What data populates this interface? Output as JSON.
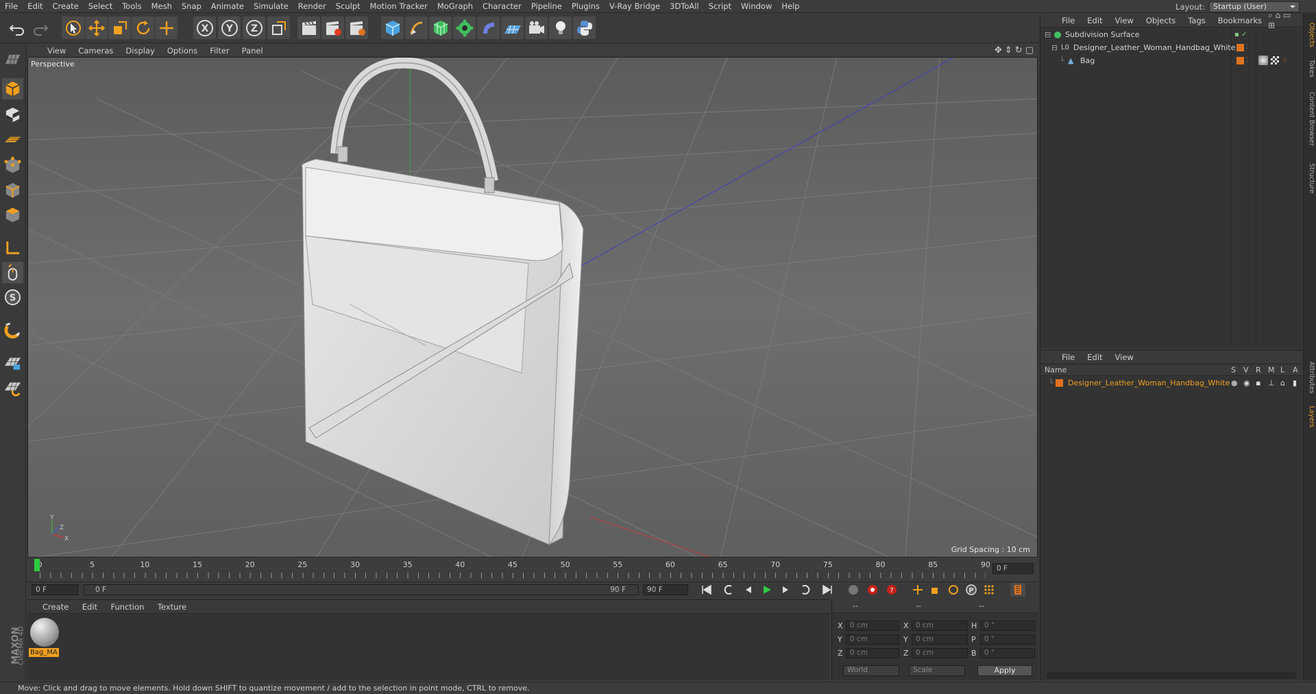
{
  "menubar": {
    "items": [
      "File",
      "Edit",
      "Create",
      "Select",
      "Tools",
      "Mesh",
      "Snap",
      "Animate",
      "Simulate",
      "Render",
      "Sculpt",
      "Motion Tracker",
      "MoGraph",
      "Character",
      "Pipeline",
      "Plugins",
      "V-Ray Bridge",
      "3DToAll",
      "Script",
      "Window",
      "Help"
    ],
    "layout_label": "Layout:",
    "layout_value": "Startup (User)"
  },
  "viewport": {
    "menu": [
      "View",
      "Cameras",
      "Display",
      "Options",
      "Filter",
      "Panel"
    ],
    "label": "Perspective",
    "grid_spacing": "Grid Spacing : 10 cm",
    "axis_x": "X",
    "axis_y": "Y",
    "axis_z": "Z"
  },
  "timeline": {
    "ticks": [
      "0",
      "5",
      "10",
      "15",
      "20",
      "25",
      "30",
      "35",
      "40",
      "45",
      "50",
      "55",
      "60",
      "65",
      "70",
      "75",
      "80",
      "85",
      "90"
    ],
    "current_frame": "0 F"
  },
  "transport": {
    "start": "0 F",
    "range_start": "0 F",
    "range_end": "90 F",
    "end": "90 F"
  },
  "materials": {
    "menu": [
      "Create",
      "Edit",
      "Function",
      "Texture"
    ],
    "items": [
      {
        "name": "Bag_MA"
      }
    ]
  },
  "coords": {
    "header": [
      "--",
      "--",
      "--"
    ],
    "rows": [
      {
        "l1": "X",
        "v1": "0 cm",
        "l2": "X",
        "v2": "0 cm",
        "l3": "H",
        "v3": "0 °"
      },
      {
        "l1": "Y",
        "v1": "0 cm",
        "l2": "Y",
        "v2": "0 cm",
        "l3": "P",
        "v3": "0 °"
      },
      {
        "l1": "Z",
        "v1": "0 cm",
        "l2": "Z",
        "v2": "0 cm",
        "l3": "B",
        "v3": "0 °"
      }
    ],
    "space": "World",
    "mode": "Scale",
    "apply": "Apply"
  },
  "objects": {
    "menu": [
      "File",
      "Edit",
      "View",
      "Objects",
      "Tags",
      "Bookmarks"
    ],
    "items": [
      {
        "name": "Subdivision Surface"
      },
      {
        "name": "Designer_Leather_Woman_Handbag_White"
      },
      {
        "name": "Bag"
      }
    ]
  },
  "layers": {
    "menu": [
      "File",
      "Edit",
      "View"
    ],
    "col_name": "Name",
    "cols": [
      "S",
      "V",
      "R",
      "M",
      "L",
      "A"
    ],
    "items": [
      {
        "name": "Designer_Leather_Woman_Handbag_White"
      }
    ]
  },
  "sidetabs": [
    "Objects",
    "Takes",
    "Content Browser",
    "Structure",
    "Attributes",
    "Layers"
  ],
  "status": "Move: Click and drag to move elements. Hold down SHIFT to quantize movement / add to the selection in point mode, CTRL to remove.",
  "brand": {
    "line1": "MAXON",
    "line2": "CINEMA 4D"
  },
  "colors": {
    "accent": "#e0731f",
    "timeline_cursor": "#2ecc40",
    "viewport_bg": "#6b6b6b"
  }
}
